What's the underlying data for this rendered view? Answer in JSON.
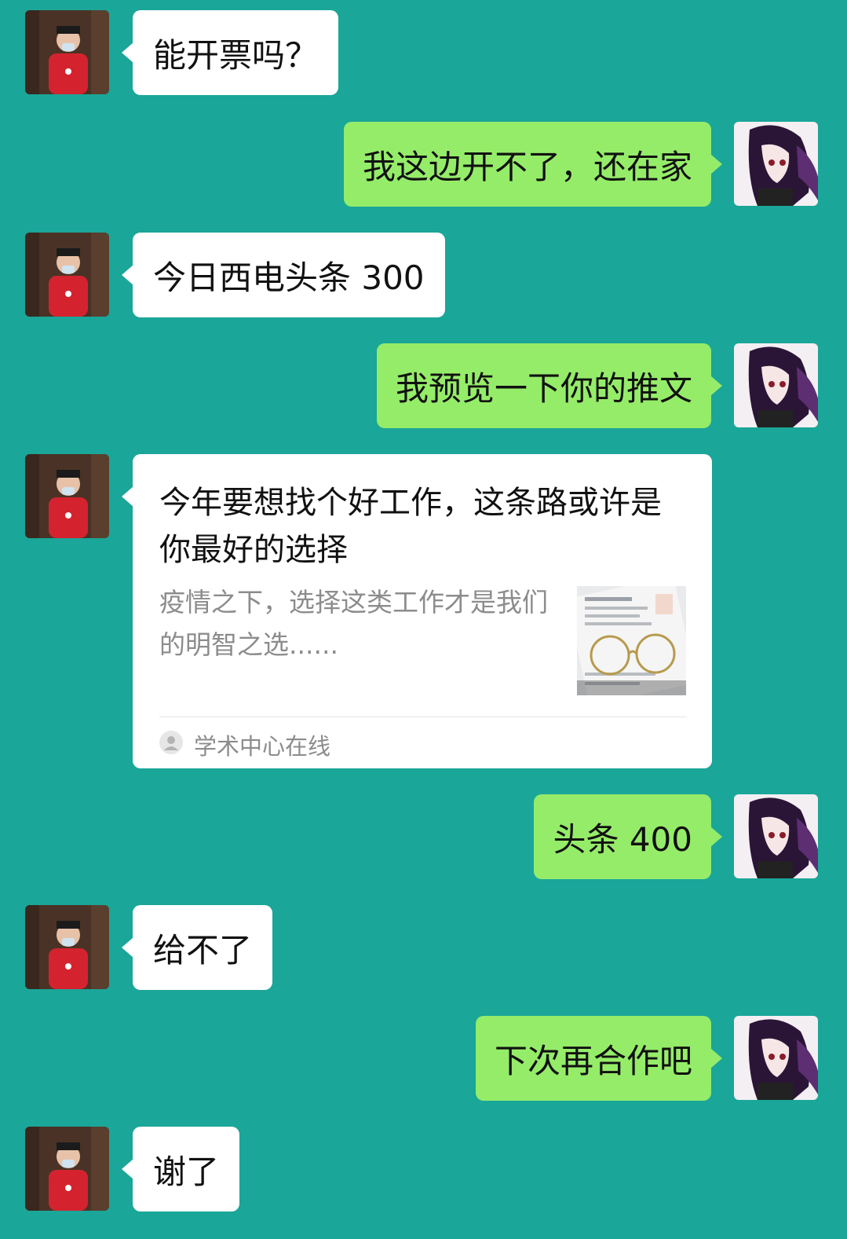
{
  "messages": [
    {
      "side": "left",
      "text": "能开票吗？"
    },
    {
      "side": "right",
      "text": "我这边开不了，还在家"
    },
    {
      "side": "left",
      "text": "今日西电头条 300"
    },
    {
      "side": "right",
      "text": "我预览一下你的推文"
    },
    {
      "side": "left",
      "type": "article-card"
    },
    {
      "side": "right",
      "text": "头条 400"
    },
    {
      "side": "left",
      "text": "给不了"
    },
    {
      "side": "right",
      "text": "下次再合作吧"
    },
    {
      "side": "left",
      "text": "谢了"
    }
  ],
  "article_card": {
    "title": "今年要想找个好工作，这条路或许是你最好的选择",
    "description": "疫情之下，选择这类工作才是我们的明智之选......",
    "source": "学术中心在线",
    "source_icon": "user-icon",
    "thumbnail": "glasses-on-resume-image"
  },
  "colors": {
    "background": "#1aa698",
    "incoming_bubble": "#ffffff",
    "outgoing_bubble": "#95ec69"
  }
}
